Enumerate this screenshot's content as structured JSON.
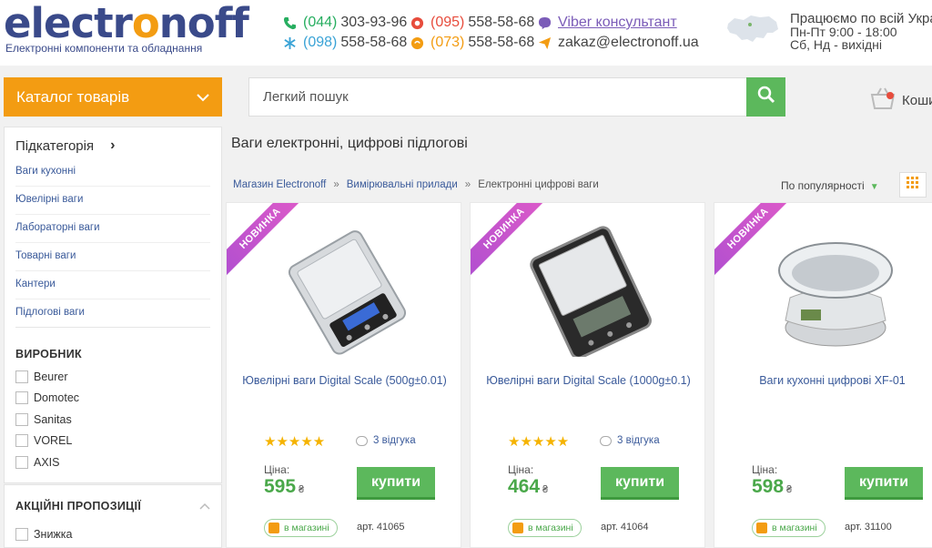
{
  "header": {
    "logo_part1": "electr",
    "logo_part2": "o",
    "logo_part3": "noff",
    "logo_tagline": "Електронні компоненти та обладнання",
    "phones": [
      {
        "code": "(044)",
        "num": "303-93-96",
        "color": "#27ae60"
      },
      {
        "code": "(098)",
        "num": "558-58-68",
        "color": "#3aa3d6"
      },
      {
        "code": "(095)",
        "num": "558-58-68",
        "color": "#e74c3c"
      },
      {
        "code": "(073)",
        "num": "558-58-68",
        "color": "#f39c12"
      }
    ],
    "viber_label": "Viber консультант",
    "email": "zakaz@electronoff.ua",
    "work_title": "Працюємо по всій Укра",
    "work_weekdays": "Пн-Пт 9:00 - 18:00",
    "work_weekend": "Сб, Нд - вихідні"
  },
  "nav": {
    "catalog_label": "Каталог товарів",
    "search_placeholder": "Легкий пошук",
    "cart_label": "Коши"
  },
  "sidebar": {
    "subcategory_title": "Підкатегорія",
    "links": [
      "Ваги кухонні",
      "Ювелірні ваги",
      "Лабораторні ваги",
      "Товарні ваги",
      "Кантери",
      "Підлогові ваги"
    ],
    "maker_title": "ВИРОБНИК",
    "makers": [
      "Beurer",
      "Domotec",
      "Sanitas",
      "VOREL",
      "AXIS"
    ],
    "promo_title": "АКЦІЙНІ ПРОПОЗИЦІЇ",
    "promo_first": "Знижка"
  },
  "content": {
    "page_title": "Ваги електронні, цифрові підлогові",
    "breadcrumbs": [
      "Магазин Electronoff",
      "Вимірювальні прилади",
      "Електронні цифрові ваги"
    ],
    "breadcrumb_sep": "»",
    "sort_label": "По популярності"
  },
  "products": [
    {
      "badge": "НОВИНКА",
      "name": "Ювелірні ваги Digital Scale (500g±0.01)",
      "stars": "★★★★★",
      "reviews": "3 відгука",
      "price_label": "Ціна:",
      "price": "595",
      "currency": "₴",
      "buy_label": "купити",
      "stock": "в магазині",
      "art": "арт. 41065"
    },
    {
      "badge": "НОВИНКА",
      "name": "Ювелірні ваги Digital Scale (1000g±0.1)",
      "stars": "★★★★★",
      "reviews": "3 відгука",
      "price_label": "Ціна:",
      "price": "464",
      "currency": "₴",
      "buy_label": "купити",
      "stock": "в магазині",
      "art": "арт. 41064"
    },
    {
      "badge": "НОВИНКА",
      "name": "Ваги кухонні цифрові XF-01",
      "stars": "",
      "reviews": "",
      "price_label": "Ціна:",
      "price": "598",
      "currency": "₴",
      "buy_label": "купити",
      "stock": "в магазині",
      "art": "арт. 31100"
    }
  ],
  "colors": {
    "accent": "#f39c12",
    "brand": "#3a4a8a",
    "buy": "#5cb85c",
    "link": "#3a5a9a"
  }
}
